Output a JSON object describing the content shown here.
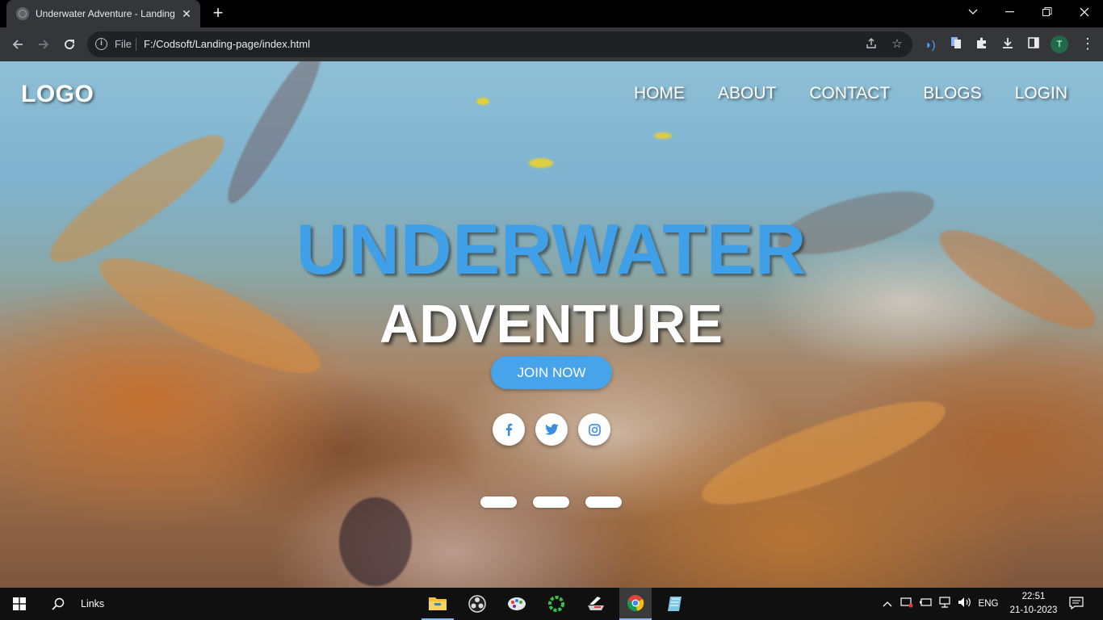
{
  "browser": {
    "tab_title": "Underwater Adventure - Landing",
    "new_tab_glyph": "+",
    "close_glyph": "✕",
    "omnibox": {
      "scheme_label": "File",
      "url": "F:/Codsoft/Landing-page/index.html"
    },
    "profile_initial": "T",
    "icons": [
      "back-icon",
      "forward-icon",
      "reload-icon",
      "info-icon",
      "share-icon",
      "star-icon",
      "extension-icon",
      "download-icon",
      "sidepanel-icon",
      "menu-icon"
    ]
  },
  "page": {
    "logo": "LOGO",
    "nav": [
      "HOME",
      "ABOUT",
      "CONTACT",
      "BLOGS",
      "LOGIN"
    ],
    "hero_line1": "UNDERWATER",
    "hero_line2": "ADVENTURE",
    "cta": "JOIN NOW",
    "social": [
      "facebook-icon",
      "twitter-icon",
      "instagram-icon"
    ],
    "slider_dots": 3,
    "colors": {
      "hero_accent": "#3fa0e8",
      "cta_bg": "#47a4ea",
      "text": "#ffffff"
    }
  },
  "taskbar": {
    "search_label": "Links",
    "language": "ENG",
    "time": "22:51",
    "date": "21-10-2023"
  }
}
